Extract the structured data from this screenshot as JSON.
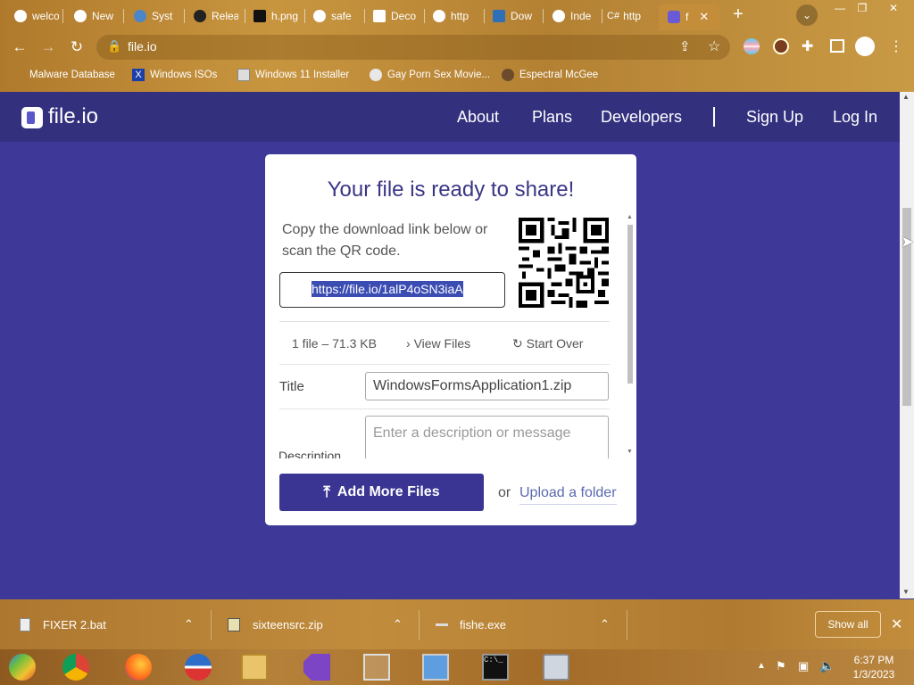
{
  "browser": {
    "tabs": [
      {
        "label": "welco"
      },
      {
        "label": "New"
      },
      {
        "label": "Syst"
      },
      {
        "label": "Relea"
      },
      {
        "label": "h.png"
      },
      {
        "label": "safe"
      },
      {
        "label": "Deco"
      },
      {
        "label": "http"
      },
      {
        "label": "Dow"
      },
      {
        "label": "Inde"
      },
      {
        "label": "http"
      },
      {
        "label": "f"
      }
    ],
    "url": "file.io",
    "bookmarks": [
      {
        "label": "Malware Database"
      },
      {
        "label": "Windows ISOs"
      },
      {
        "label": "Windows 11 Installer"
      },
      {
        "label": "Gay Porn Sex Movie..."
      },
      {
        "label": "Espectral McGee"
      }
    ]
  },
  "site": {
    "logo": "file.io",
    "nav": {
      "about": "About",
      "plans": "Plans",
      "developers": "Developers",
      "signup": "Sign Up",
      "login": "Log In"
    }
  },
  "card": {
    "title": "Your file is ready to share!",
    "copy_text": "Copy the download link below or scan the QR code.",
    "link": "https://file.io/1alP4oSN3iaA",
    "file_info": "1 file – 71.3 KB",
    "view_files": "View Files",
    "start_over": "Start Over",
    "title_label": "Title",
    "title_value": "WindowsFormsApplication1.zip",
    "description_label": "Description",
    "description_placeholder": "Enter a description or message",
    "add_more": "Add More Files",
    "or": "or",
    "upload_folder": "Upload a folder"
  },
  "downloads": {
    "items": [
      {
        "name": "FIXER 2.bat"
      },
      {
        "name": "sixteensrc.zip"
      },
      {
        "name": "fishe.exe"
      }
    ],
    "show_all": "Show all"
  },
  "taskbar": {
    "time": "6:37 PM",
    "date": "1/3/2023"
  },
  "colors": {
    "site_background": "#3e3898",
    "nav_background": "#33307e",
    "button": "#3a3592",
    "selection": "#3b4db3"
  }
}
